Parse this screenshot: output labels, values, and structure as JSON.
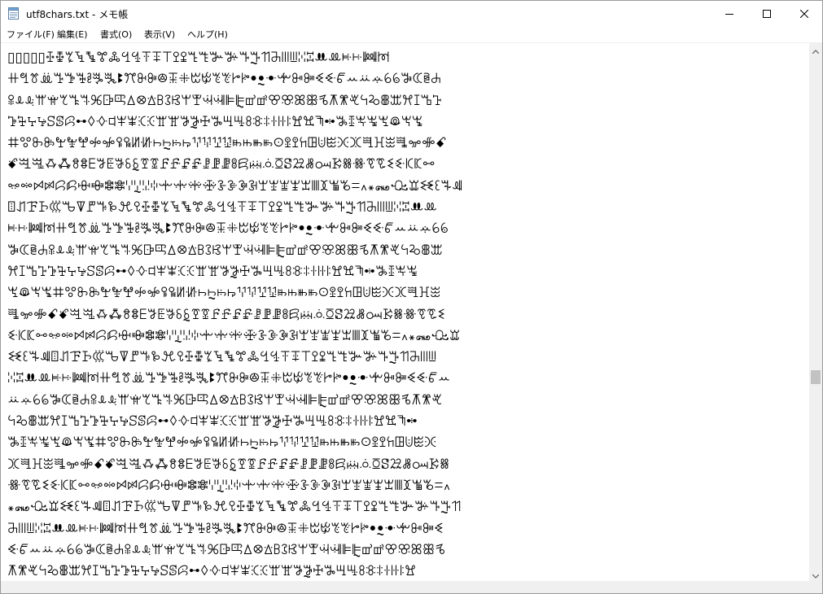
{
  "window": {
    "title": "utf8chars.txt - メモ帳"
  },
  "menu": {
    "file": "ファイル(F)",
    "edit": "編集(E)",
    "format": "書式(O)",
    "view": "表示(V)",
    "help": "ヘルプ(H)"
  },
  "icons": {
    "app": "notepad-icon",
    "minimize": "minimize-icon",
    "maximize": "maximize-icon",
    "close": "close-icon",
    "scroll_up": "scroll-up-arrow-icon",
    "scroll_down": "scroll-down-arrow-icon"
  },
  "editor": {
    "content": "▯▯▯▯▯ꔀꔁꔂꔃꔄꔅꔆꔇꔈꔉꔊꔋꔌꔍꔎꔏꔐꔑꔒꔓꔔꔕꔖꔗꔘꔙꔚꔛꔜꔝꔞꔟ\nꔠꔡꔢꔣꔤꔥꔦꔧꔨꔩꔪꔫꔬꔭꔮꔯꔰꔱꔲꔳꔴꔵꔶꔷꔸꔹꔺꔻꔼꔽꔾꔿꕀꕁꕂꕃꕄꕅꕆꕇꕈ\nꕉꕊꕋꕌꕍꕎꕏꕐꕑꕒꕓꕔꕕꕖꕗꕘꕙꕚꕛꕜꕝꕞꕟꕠꕡꕢꕣꕤꕥꕦꕧꕨꕩꕪꕫꕬꕭꕮꕯꕰꕱ\nꕲꕳꕴꕵꕶꕷꕸꕹꕺꕻꕼꕽꕾꕿꖀꖁꖂꖃꖄꖅꖆꖇꖈꖉꖊꖋꖌꖍꖎꖏꖐꖑꖒꖓꖔꖕꖖꖗꖘꖙꖚ\nꖛꖜꖝꖞꖟꖠꖡꖢꖣꖤꖥꖦꖧꖨꖩꖪꖫꖬꖭꖮꖯꖰꖱꖲꖳꖴꖵꖶꖷꖸꖹꖺꖻꖼꖽꖾꖿꗀꗁꗂꗃ\nꗄꗅꗆꗇꗈꗉꗊꗋꗌꗍꗎꗏꗐꗑꗒꗓꗔꗕꗖꗗꗘꗙꗚꗛꗜꗝꗞꗟꗠꗡꗢꗣꗤꗥꗦꗧꗨꗩꗪꗫꗬ\nꗭꗮꗯꗰꗱꗲꗳꗴꗵꗶꗷꗸꗹꗺꗻꗼꗽꗾꗿꘀꘁꘂꘃꘄꘅꘆꘇꘈꘉꘊꘋꘌ꘍꘎꘏ꘐꘑꘒꘓꘔꘕ\nꘖꘗꘘꘙꘚꘛꘜꘝꘞꘟꘪꘫꔀꔁꔂꔃꔄꔅꔆꔇꔈꔉꔊꔋꔌꔍꔎꔏꔐꔑꔒꔓꔔꔕꔖꔗꔘꔙꔚꔛ\nꔜꔝꔞꔟꔠꔡꔢꔣꔤꔥꔦꔧꔨꔩꔪꔫꔬꔭꔮꔯꔰꔱꔲꔳꔴꔵꔶꔷꔸꔹꔺꔻꔼꔽꔾꔿꕀꕁꕂꕃꕄ\nꕅꕆꕇꕈꕉꕊꕋꕌꕍꕎꕏꕐꕑꕒꕓꕔꕕꕖꕗꕘꕙꕚꕛꕜꕝꕞꕟꕠꕡꕢꕣꕤꕥꕦꕧꕨꕩꕪꕫꕬꕭ\nꕮꕯꕰꕱꕲꕳꕴꕵꕶꕷꕸꕹꕺꕻꕼꕽꕾꕿꖀꖁꖂꖃꖄꖅꖆꖇꖈꖉꖊꖋꖌꖍꖎꖏꖐꖑꖒꖓꖔꖕꖖ\nꖗꖘꖙꖚꖛꖜꖝꖞꖟꖠꖡꖢꖣꖤꖥꖦꖧꖨꖩꖪꖫꖬꖭꖮꖯꖰꖱꖲꖳꖴꖵꖶꖷꖸꖹꖺꖻꖼꖽꖾꖿ\nꗀꗁꗂꗃꗄꗅꗆꗇꗈꗉꗊꗋꗌꗍꗎꗏꗐꗑꗒꗓꗔꗕꗖꗗꗘꗙꗚꗛꗜꗝꗞꗟꗠꗡꗢꗣꗤꗥꗦꗧꗨ\nꗩꗪꗫꗬꗭꗮꗯꗰꗱꗲꗳꗴꗵꗶꗷꗸꗹꗺꗻꗼꗽꗾꗿꘀꘁꘂꘃꘄꘅꘆꘇꘈꘉꘊꘋꘌ꘍꘎꘏ꘐꘑ\nꘒꘓꘔꘕꘖꘗꘘꘙꘚꘛꘜꘝꘞꘟꘪꘫꔀꔁꔂꔃꔄꔅꔆꔇꔈꔉꔊꔋꔌꔍꔎꔏꔐꔑꔒꔓꔔꔕꔖꔗ\nꔘꔙꔚꔛꔜꔝꔞꔟꔠꔡꔢꔣꔤꔥꔦꔧꔨꔩꔪꔫꔬꔭꔮꔯꔰꔱꔲꔳꔴꔵꔶꔷꔸꔹꔺꔻꔼꔽꔾꔿꕀ\nꕁꕂꕃꕄꕅꕆꕇꕈꕉꕊꕋꕌꕍꕎꕏꕐꕑꕒꕓꕔꕕꕖꕗꕘꕙꕚꕛꕜꕝꕞꕟꕠꕡꕢꕣꕤꕥꕦꕧꕨꕩ\nꕪꕫꕬꕭꕮꕯꕰꕱꕲꕳꕴꕵꕶꕷꕸꕹꕺꕻꕼꕽꕾꕿꖀꖁꖂꖃꖄꖅꖆꖇꖈꖉꖊꖋꖌꖍꖎꖏꖐꖑꖒ\nꖓꖔꖕꖖꖗꖘꖙꖚꖛꖜꖝꖞꖟꖠꖡꖢꖣꖤꖥꖦꖧꖨꖩꖪꖫꖬꖭꖮꖯꖰꖱꖲꖳꖴꖵꖶꖷꖸꖹꖺꖻ\nꖼꖽꖾꖿꗀꗁꗂꗃꗄꗅꗆꗇꗈꗉꗊꗋꗌꗍꗎꗏꗐꗑꗒꗓꗔꗕꗖꗗꗘꗙꗚꗛꗜꗝꗞꗟꗠꗡꗢꗣꗤ\nꗥꗦꗧꗨꗩꗪꗫꗬꗭꗮꗯꗰꗱꗲꗳꗴꗵꗶꗷꗸꗹꗺꗻꗼꗽꗾꗿꘀꘁꘂꘃꘄꘅꘆꘇꘈꘉꘊꘋꘌ꘍\n꘎꘏ꘐꘑꘒꘓꘔꘕꘖꘗꘘꘙꘚꘛꘜꘝꘞꘟꘪꘫꔀꔁꔂꔃꔄꔅꔆꔇꔈꔉꔊꔋꔌꔍꔎꔏꔐꔑꔒꔓꔔ\nꔕꔖꔗꔘꔙꔚꔛꔜꔝꔞꔟꔠꔡꔢꔣꔤꔥꔦꔧꔨꔩꔪꔫꔬꔭꔮꔯꔰꔱꔲꔳꔴꔵꔶꔷꔸꔹꔺꔻꔼꔽ\nꔾꔿꕀꕁꕂꕃꕄꕅꕆꕇꕈꕉꕊꕋꕌꕍꕎꕏꕐꕑꕒꕓꕔꕕꕖꕗꕘꕙꕚꕛꕜꕝꕞꕟꕠꕡꕢꕣꕤꕥꕦ\nꕧꕨꕩꕪꕫꕬꕭꕮꕯꕰꕱꕲꕳꕴꕵꕶꕷꕸꕹꕺꕻꕼꕽꕾꕿꖀꖁꖂꖃꖄꖅꖆꖇꖈꖉꖊꖋꖌꖍꖎꖏ"
  }
}
